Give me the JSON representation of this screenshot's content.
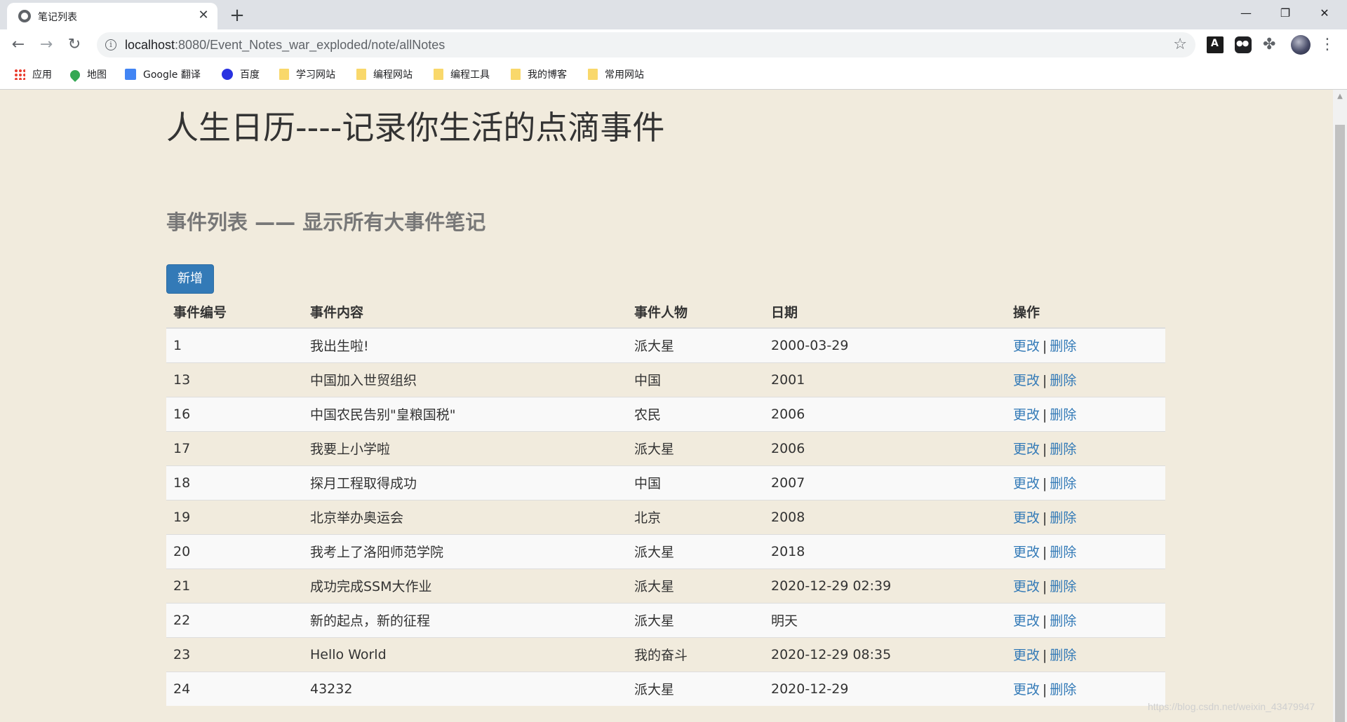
{
  "browser": {
    "tab_title": "笔记列表",
    "url_host": "localhost",
    "url_path": ":8080/Event_Notes_war_exploded/note/allNotes",
    "bookmarks": [
      {
        "label": "应用",
        "icon": "apps-icon"
      },
      {
        "label": "地图",
        "icon": "maps-icon"
      },
      {
        "label": "Google 翻译",
        "icon": "translate-icon"
      },
      {
        "label": "百度",
        "icon": "baidu-icon"
      },
      {
        "label": "学习网站",
        "icon": "folder-icon"
      },
      {
        "label": "编程网站",
        "icon": "folder-icon"
      },
      {
        "label": "编程工具",
        "icon": "folder-icon"
      },
      {
        "label": "我的博客",
        "icon": "folder-icon"
      },
      {
        "label": "常用网站",
        "icon": "folder-icon"
      }
    ]
  },
  "page": {
    "title": "人生日历----记录你生活的点滴事件",
    "subtitle": "事件列表 —— 显示所有大事件笔记",
    "add_button": "新增",
    "columns": [
      "事件编号",
      "事件内容",
      "事件人物",
      "日期",
      "操作"
    ],
    "edit_label": "更改",
    "separator": "|",
    "delete_label": "删除",
    "rows": [
      {
        "id": "1",
        "content": "我出生啦!",
        "person": "派大星",
        "date": "2000-03-29"
      },
      {
        "id": "13",
        "content": "中国加入世贸组织",
        "person": "中国",
        "date": "2001"
      },
      {
        "id": "16",
        "content": "中国农民告别\"皇粮国税\"",
        "person": "农民",
        "date": "2006"
      },
      {
        "id": "17",
        "content": "我要上小学啦",
        "person": "派大星",
        "date": "2006"
      },
      {
        "id": "18",
        "content": "探月工程取得成功",
        "person": "中国",
        "date": "2007"
      },
      {
        "id": "19",
        "content": "北京举办奥运会",
        "person": "北京",
        "date": "2008"
      },
      {
        "id": "20",
        "content": "我考上了洛阳师范学院",
        "person": "派大星",
        "date": "2018"
      },
      {
        "id": "21",
        "content": "成功完成SSM大作业",
        "person": "派大星",
        "date": "2020-12-29 02:39"
      },
      {
        "id": "22",
        "content": "新的起点，新的征程",
        "person": "派大星",
        "date": "明天"
      },
      {
        "id": "23",
        "content": "Hello World",
        "person": "我的奋斗",
        "date": "2020-12-29 08:35"
      },
      {
        "id": "24",
        "content": "43232",
        "person": "派大星",
        "date": "2020-12-29"
      }
    ],
    "watermark": "https://blog.csdn.net/weixin_43479947"
  },
  "colors": {
    "page_background": "#f1ebdd",
    "primary_button": "#337ab7",
    "link": "#337ab7"
  }
}
